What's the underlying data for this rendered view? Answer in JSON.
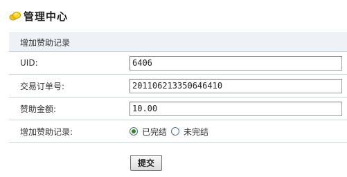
{
  "header": {
    "title": "管理中心",
    "icon": "yellow-blob-icon"
  },
  "form": {
    "section_title": "增加赞助记录",
    "fields": [
      {
        "label": "UID:",
        "value": "6406"
      },
      {
        "label": "交易订单号:",
        "value": "201106213350646410"
      },
      {
        "label": "赞助金额:",
        "value": "10.00"
      }
    ],
    "status": {
      "label": "增加赞助记录:",
      "options": [
        {
          "label": "已完结",
          "selected": true
        },
        {
          "label": "未完结",
          "selected": false
        }
      ]
    },
    "submit_label": "提交"
  },
  "colors": {
    "row_border": "#c9d6e3",
    "section_bg": "#eef2f7",
    "radio_selected": "#2b8a1f"
  }
}
